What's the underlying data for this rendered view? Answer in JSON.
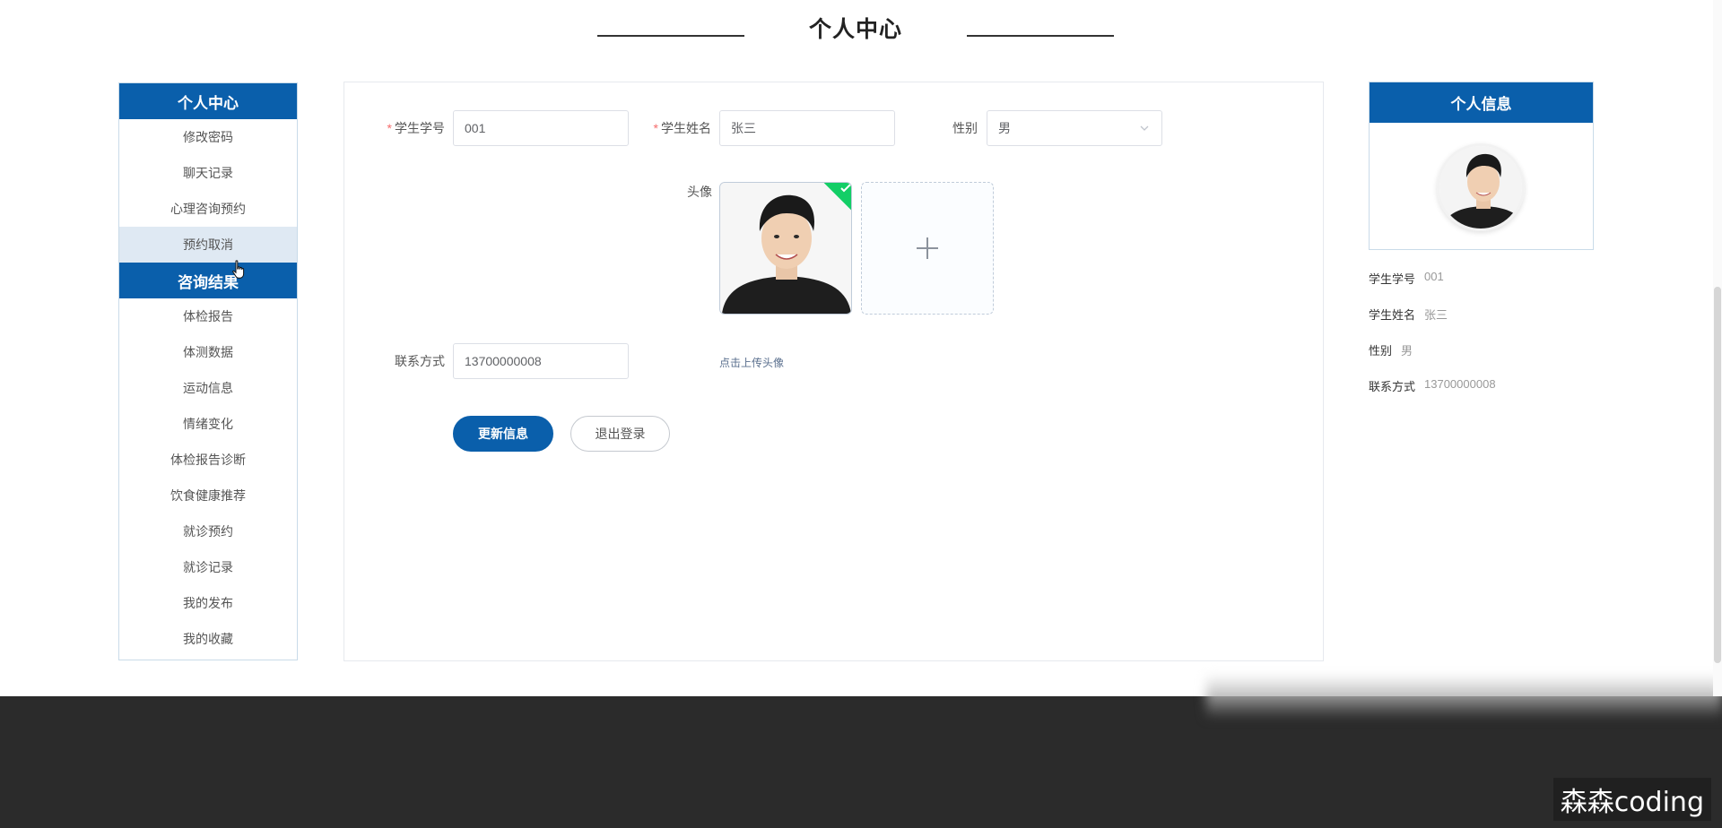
{
  "page": {
    "title": "个人中心"
  },
  "sidebar": {
    "header": "个人中心",
    "items": [
      {
        "label": "修改密码"
      },
      {
        "label": "聊天记录"
      },
      {
        "label": "心理咨询预约"
      },
      {
        "label": "预约取消",
        "state": "hover"
      },
      {
        "label": "咨询结果",
        "state": "active"
      },
      {
        "label": "体检报告"
      },
      {
        "label": "体测数据"
      },
      {
        "label": "运动信息"
      },
      {
        "label": "情绪变化"
      },
      {
        "label": "体检报告诊断"
      },
      {
        "label": "饮食健康推荐"
      },
      {
        "label": "就诊预约"
      },
      {
        "label": "就诊记录"
      },
      {
        "label": "我的发布"
      },
      {
        "label": "我的收藏"
      }
    ]
  },
  "form": {
    "student_no": {
      "label": "学生学号",
      "value": "001",
      "required": "*"
    },
    "student_name": {
      "label": "学生姓名",
      "value": "张三",
      "required": "*"
    },
    "gender": {
      "label": "性别",
      "value": "男"
    },
    "avatar": {
      "label": "头像",
      "upload_tip": "点击上传头像"
    },
    "phone": {
      "label": "联系方式",
      "value": "13700000008"
    },
    "buttons": {
      "update": "更新信息",
      "logout": "退出登录"
    }
  },
  "profile": {
    "header": "个人信息",
    "rows": [
      {
        "key": "学生学号",
        "value": "001"
      },
      {
        "key": "学生姓名",
        "value": "张三"
      },
      {
        "key": "性别",
        "value": "男"
      },
      {
        "key": "联系方式",
        "value": "13700000008"
      }
    ]
  },
  "watermark": "森森coding",
  "colors": {
    "primary": "#0a5fab",
    "success": "#13ce66",
    "required": "#f56c6c",
    "footer": "#2b2b2b"
  },
  "icons": [
    "check-icon",
    "plus-icon",
    "chevron-down-icon",
    "hand-pointer-icon"
  ]
}
